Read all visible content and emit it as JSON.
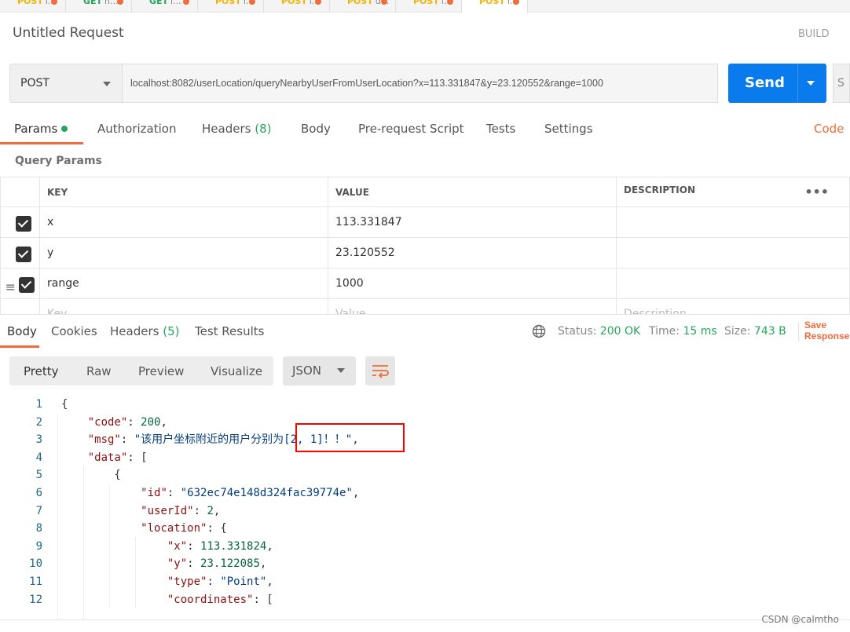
{
  "tabs": [
    {
      "method": "POST",
      "label": "i...",
      "color": "#f4b400"
    },
    {
      "method": "GET",
      "label": "n...",
      "color": "#26a65b"
    },
    {
      "method": "GET",
      "label": "i...",
      "color": "#26a65b"
    },
    {
      "method": "POST",
      "label": "i...",
      "color": "#f4b400"
    },
    {
      "method": "POST",
      "label": "i...",
      "color": "#f4b400"
    },
    {
      "method": "POST",
      "label": "d...",
      "color": "#f4b400"
    },
    {
      "method": "POST",
      "label": "i...",
      "color": "#f4b400"
    },
    {
      "method": "POST",
      "label": "i...",
      "color": "#f4b400",
      "active": true
    }
  ],
  "request": {
    "title": "Untitled Request",
    "build": "BUILD",
    "method": "POST",
    "url": "localhost:8082/userLocation/queryNearbyUserFromUserLocation?x=113.331847&y=23.120552&range=1000",
    "send": "Send",
    "save": "S"
  },
  "req_tabs": {
    "params": "Params",
    "authorization": "Authorization",
    "headers": "Headers",
    "headers_count": "(8)",
    "body": "Body",
    "prerequest": "Pre-request Script",
    "tests": "Tests",
    "settings": "Settings",
    "code": "Code"
  },
  "query_params": {
    "title": "Query Params",
    "headers": [
      "KEY",
      "VALUE",
      "DESCRIPTION"
    ],
    "rows": [
      {
        "key": "x",
        "value": "113.331847",
        "checked": true
      },
      {
        "key": "y",
        "value": "23.120552",
        "checked": true
      },
      {
        "key": "range",
        "value": "1000",
        "checked": true
      }
    ],
    "placeholder": {
      "key": "Key",
      "value": "Value",
      "description": "Description"
    }
  },
  "response": {
    "tabs": {
      "body": "Body",
      "cookies": "Cookies",
      "headers": "Headers",
      "headers_count": "(5)",
      "tests": "Test Results"
    },
    "status_label": "Status:",
    "status": "200 OK",
    "time_label": "Time:",
    "time": "15 ms",
    "size_label": "Size:",
    "size": "743 B",
    "save": "Save Response",
    "views": [
      "Pretty",
      "Raw",
      "Preview",
      "Visualize"
    ],
    "format": "JSON"
  },
  "code_lines": [
    "{",
    "    \"code\": 200,",
    "    \"msg\": \"该用户坐标附近的用户分别为[2, 1]！！\",",
    "    \"data\": [",
    "        {",
    "            \"id\": \"632ec74e148d324fac39774e\",",
    "            \"userId\": 2,",
    "            \"location\": {",
    "                \"x\": 113.331824,",
    "                \"y\": 23.122085,",
    "                \"type\": \"Point\",",
    "                \"coordinates\": ["
  ],
  "watermark": "CSDN @calmtho"
}
